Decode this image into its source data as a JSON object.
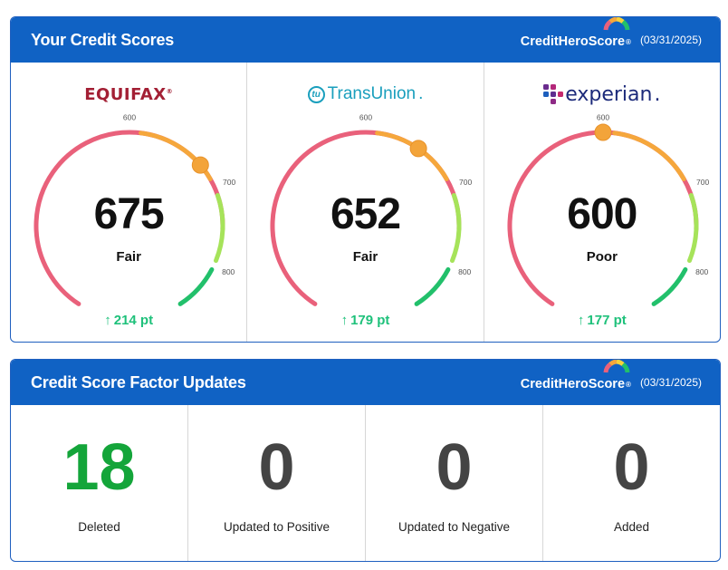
{
  "colors": {
    "header_blue": "#1062c4",
    "arc_poor": "#e9617b",
    "arc_fair": "#f5a73c",
    "arc_good": "#a6e35a",
    "arc_excellent": "#22c06b",
    "marker": "#f3a43a",
    "change_green": "#1fc17b",
    "deleted_green": "#14a53a",
    "zero_gray": "#444444"
  },
  "scores_card": {
    "title": "Your Credit Scores",
    "brand": {
      "text_a": "CreditHero",
      "text_b": "Score",
      "reg": "®"
    },
    "date": "(03/31/2025)",
    "ticks": {
      "t600": "600",
      "t700": "700",
      "t800": "800"
    },
    "bureaus": [
      {
        "logo_icon": "equifax-logo",
        "logo_text": "EQUIFAX",
        "logo_reg": "®",
        "score": 675,
        "score_text": "675",
        "rating": "Fair",
        "change_arrow": "↑",
        "change": "214 pt"
      },
      {
        "logo_icon": "transunion-logo",
        "logo_mark": "tu",
        "logo_text": "TransUnion",
        "logo_suffix": ".",
        "score": 652,
        "score_text": "652",
        "rating": "Fair",
        "change_arrow": "↑",
        "change": "179 pt"
      },
      {
        "logo_icon": "experian-logo",
        "logo_text": "experian",
        "logo_suffix": ".",
        "score": 600,
        "score_text": "600",
        "rating": "Poor",
        "change_arrow": "↑",
        "change": "177 pt"
      }
    ]
  },
  "factors_card": {
    "title": "Credit Score Factor Updates",
    "brand": {
      "text_a": "CreditHero",
      "text_b": "Score",
      "reg": "®"
    },
    "date": "(03/31/2025)",
    "items": [
      {
        "value": "18",
        "label": "Deleted"
      },
      {
        "value": "0",
        "label": "Updated to Positive"
      },
      {
        "value": "0",
        "label": "Updated to Negative"
      },
      {
        "value": "0",
        "label": "Added"
      }
    ]
  }
}
